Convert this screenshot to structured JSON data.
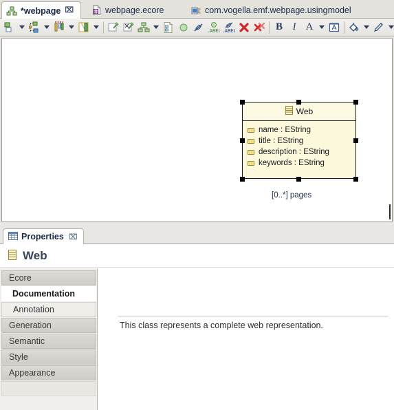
{
  "editor": {
    "tabs": [
      {
        "label": "*webpage",
        "icon": "diagram-icon",
        "active": true,
        "closable": true
      },
      {
        "label": "webpage.ecore",
        "icon": "ecore-file-icon",
        "active": false,
        "closable": false
      },
      {
        "label": "com.vogella.emf.webpage.usingmodel",
        "icon": "java-package-icon",
        "active": false,
        "closable": false
      }
    ],
    "close_glyph": "⌧"
  },
  "toolbar": {
    "items": [
      {
        "name": "select-tool",
        "type": "button",
        "icon": "two-squares-icon"
      },
      {
        "name": "select-tool-dropdown",
        "type": "caret"
      },
      {
        "name": "arrange-tool",
        "type": "button",
        "icon": "arrange-icon"
      },
      {
        "name": "arrange-tool-dropdown",
        "type": "caret"
      },
      {
        "name": "align-tool",
        "type": "button",
        "icon": "align-icon"
      },
      {
        "name": "align-tool-dropdown",
        "type": "caret"
      },
      {
        "name": "match-size-tool",
        "type": "button",
        "icon": "match-size-icon"
      },
      {
        "name": "match-size-dropdown",
        "type": "caret"
      },
      {
        "name": "separator-1",
        "type": "separator"
      },
      {
        "name": "pin-tool",
        "type": "button",
        "icon": "pin-icon"
      },
      {
        "name": "unpin-tool",
        "type": "button",
        "icon": "unpin-icon"
      },
      {
        "name": "layout-tool",
        "type": "button",
        "icon": "hierarchy-icon"
      },
      {
        "name": "layout-tool-dropdown",
        "type": "caret"
      },
      {
        "name": "page-layout-tool",
        "type": "button",
        "icon": "page-layout-icon"
      },
      {
        "name": "show-hide-tool",
        "type": "button",
        "icon": "circle-green-icon"
      },
      {
        "name": "hide-tool",
        "type": "button",
        "icon": "hide-connector-icon"
      },
      {
        "name": "show-labels-tool",
        "type": "button",
        "icon": "show-label-icon"
      },
      {
        "name": "hide-labels-tool",
        "type": "button",
        "icon": "hide-label-icon"
      },
      {
        "name": "delete-tool",
        "type": "button",
        "icon": "red-x-icon"
      },
      {
        "name": "delete-all-tool",
        "type": "button",
        "icon": "red-x-multi-icon"
      },
      {
        "name": "separator-2",
        "type": "separator"
      },
      {
        "name": "bold-button",
        "type": "text",
        "label": "B"
      },
      {
        "name": "italic-button",
        "type": "text",
        "label": "I"
      },
      {
        "name": "font-button",
        "type": "text",
        "label": "A"
      },
      {
        "name": "font-dropdown",
        "type": "caret"
      },
      {
        "name": "font-dialog-button",
        "type": "button",
        "icon": "font-dialog-icon"
      },
      {
        "name": "separator-3",
        "type": "separator"
      },
      {
        "name": "fill-color-button",
        "type": "button",
        "icon": "paint-bucket-icon"
      },
      {
        "name": "fill-color-dropdown",
        "type": "caret"
      },
      {
        "name": "line-color-button",
        "type": "button",
        "icon": "pen-icon"
      },
      {
        "name": "line-color-dropdown",
        "type": "caret"
      },
      {
        "name": "line-style-button",
        "type": "button",
        "icon": "arrow-right-icon"
      },
      {
        "name": "line-style-dropdown",
        "type": "caret"
      },
      {
        "name": "image-button",
        "type": "button",
        "icon": "image-icon"
      }
    ]
  },
  "diagram": {
    "node": {
      "name": "Web",
      "icon": "eclass-icon",
      "selected": true,
      "attributes": [
        {
          "label": "name : EString",
          "icon": "eattribute-icon"
        },
        {
          "label": "title : EString",
          "icon": "eattribute-icon"
        },
        {
          "label": "description : EString",
          "icon": "eattribute-icon"
        },
        {
          "label": "keywords : EString",
          "icon": "eattribute-icon"
        }
      ]
    },
    "association": {
      "multiplicity_label": "[0..*] pages",
      "end_decoration": "filled-diamond"
    },
    "fill_color": "#fbf8dc",
    "border_color": "#1c1c1c",
    "handle_color": "#000000"
  },
  "properties": {
    "view_tab": {
      "label": "Properties",
      "icon": "properties-table-icon",
      "close_glyph": "⌧"
    },
    "header": {
      "title": "Web",
      "icon": "eclass-icon"
    },
    "tabs": [
      {
        "label": "Ecore",
        "state": "normal"
      },
      {
        "label": "Documentation",
        "state": "selected"
      },
      {
        "label": "Annotation",
        "state": "hover"
      },
      {
        "label": "Generation",
        "state": "normal"
      },
      {
        "label": "Semantic",
        "state": "normal"
      },
      {
        "label": "Style",
        "state": "normal"
      },
      {
        "label": "Appearance",
        "state": "normal"
      }
    ],
    "documentation": {
      "value": "This class represents a complete web representation.",
      "placeholder": ""
    }
  }
}
